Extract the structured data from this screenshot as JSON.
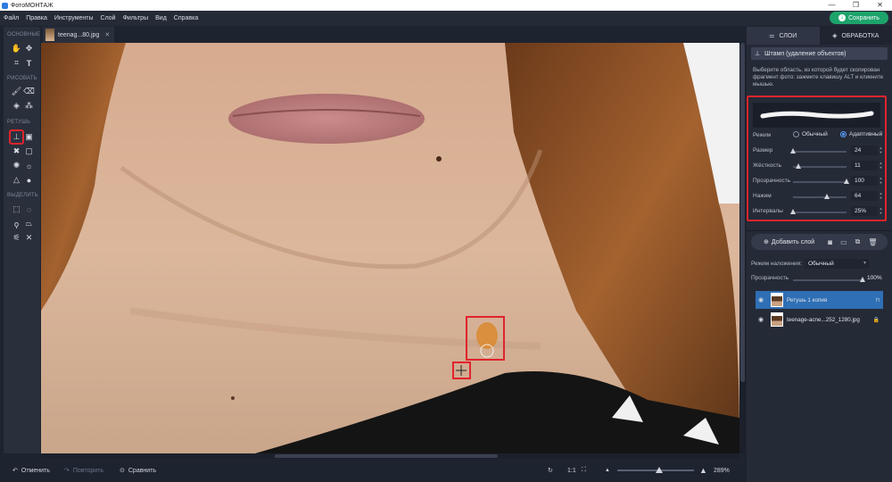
{
  "app": {
    "title": "ФотоМОНТАЖ",
    "win_controls": [
      "—",
      "❐",
      "✕"
    ]
  },
  "menu": [
    "Файл",
    "Правка",
    "Инструменты",
    "Слой",
    "Фильтры",
    "Вид",
    "Справка"
  ],
  "save_button": "Сохранить",
  "tools": {
    "sections": [
      "ОСНОВНЫЕ",
      "РИСОВАТЬ",
      "РЕТУШЬ",
      "ВЫДЕЛИТЬ"
    ]
  },
  "doc_tab": {
    "name": "teenag...80.jpg",
    "close": "✕"
  },
  "bottom": {
    "undo": "Отменить",
    "redo": "Повторить",
    "compare": "Сравнить",
    "ratio": "1:1",
    "zoom": "289%",
    "zoom_level": 0.55
  },
  "right_panel": {
    "tabs": [
      "СЛОИ",
      "ОБРАБОТКА"
    ],
    "stamp_button": "Штамп (удаление объектов)",
    "hint": "Выберите область, из которой будет скопирован фрагмент фото: зажмите клавишу ALT и кликните мышью.",
    "mode_label": "Режим",
    "mode_options": [
      "Обычный",
      "Адаптивный"
    ],
    "mode_selected": "Адаптивный",
    "params": [
      {
        "label": "Размер",
        "value": "24",
        "level": 0.0
      },
      {
        "label": "Жёсткость",
        "value": "11",
        "level": 0.1
      },
      {
        "label": "Прозрачность",
        "value": "100",
        "level": 1.0
      },
      {
        "label": "Нажим",
        "value": "64",
        "level": 0.64
      },
      {
        "label": "Интервалы",
        "value": "25%",
        "level": 0.0
      }
    ],
    "add_layer": "Добавить слой",
    "blend_label": "Режим наложения:",
    "blend_value": "Обычный",
    "opacity_label": "Прозрачность",
    "opacity_value": "100%",
    "layers": [
      {
        "name": "Ретушь 1 копия",
        "selected": true
      },
      {
        "name": "teenage-acne...252_1280.jpg",
        "selected": false
      }
    ]
  }
}
